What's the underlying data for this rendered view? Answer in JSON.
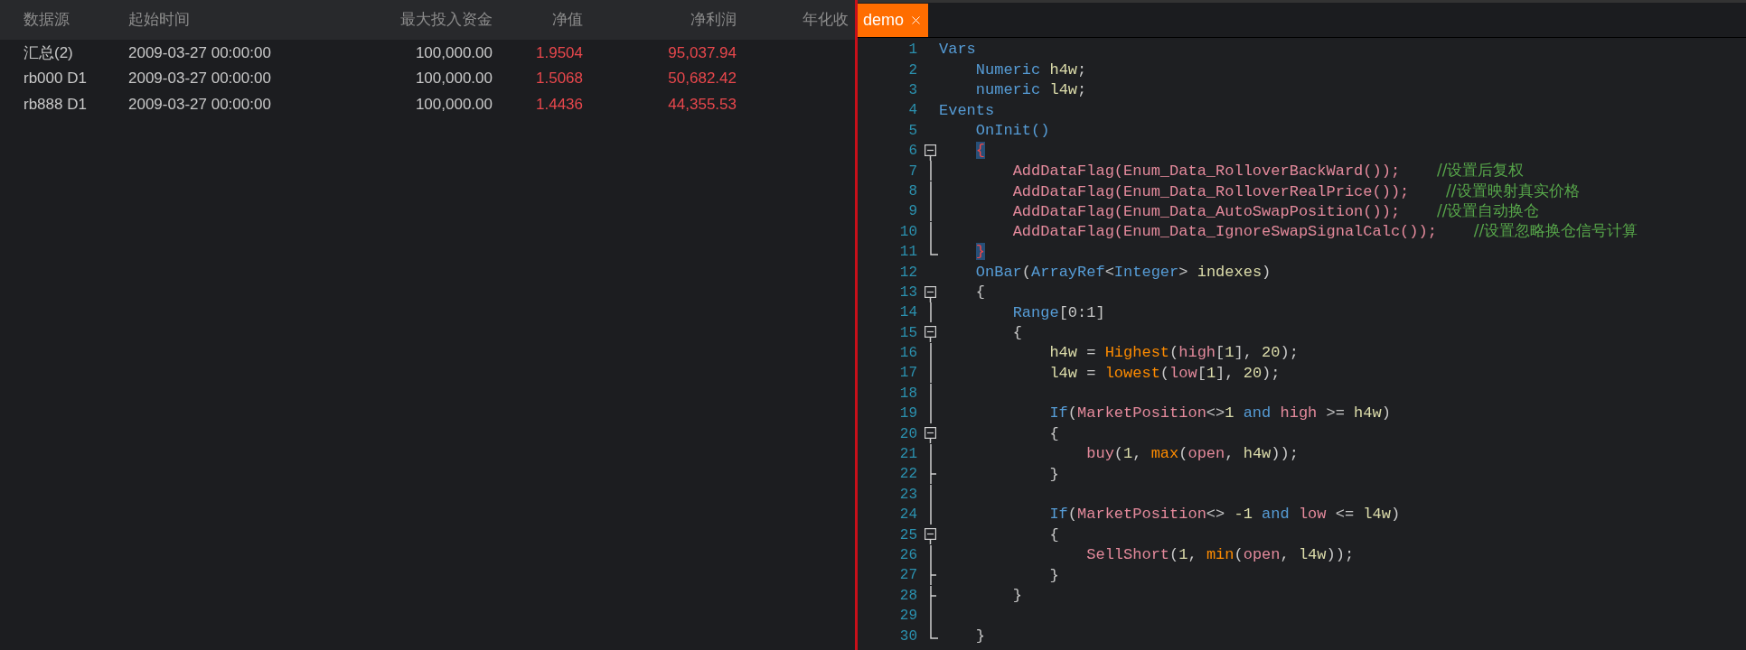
{
  "results_table": {
    "columns": [
      "数据源",
      "起始时间",
      "最大投入资金",
      "净值",
      "净利润",
      "年化收"
    ],
    "rows": [
      [
        "汇总(2)",
        "2009-03-27 00:00:00",
        "100,000.00",
        "1.9504",
        "95,037.94"
      ],
      [
        "rb000 D1",
        "2009-03-27 00:00:00",
        "100,000.00",
        "1.5068",
        "50,682.42"
      ],
      [
        "rb888 D1",
        "2009-03-27 00:00:00",
        "100,000.00",
        "1.4436",
        "44,355.53"
      ]
    ]
  },
  "editor": {
    "tabs": [
      {
        "label": "demo",
        "selected": true
      }
    ],
    "lines": [
      {
        "n": "1",
        "kind": "plain",
        "tokens": [
          {
            "kind": "kw",
            "t": "Vars"
          }
        ]
      },
      {
        "n": "2",
        "kind": "plain",
        "tokens": [
          {
            "kind": "kw",
            "t": "    Numeric "
          },
          {
            "kind": "var",
            "t": "h4w"
          },
          {
            "kind": "p",
            "t": ";"
          }
        ]
      },
      {
        "n": "3",
        "kind": "plain",
        "tokens": [
          {
            "kind": "kw",
            "t": "    numeric "
          },
          {
            "kind": "var",
            "t": "l4w"
          },
          {
            "kind": "p",
            "t": ";"
          }
        ]
      },
      {
        "n": "4",
        "kind": "plain",
        "tokens": [
          {
            "kind": "kw",
            "t": "Events"
          }
        ]
      },
      {
        "n": "5",
        "kind": "plain",
        "tokens": [
          {
            "kind": "kw",
            "t": "    OnInit()"
          }
        ]
      },
      {
        "n": "6",
        "kind": "open",
        "tokens": [
          {
            "kind": "brace",
            "t": "    {"
          }
        ]
      },
      {
        "n": "7",
        "kind": "line",
        "tokens": [
          {
            "kind": "fn",
            "t": "        AddDataFlag(Enum_Data_RolloverBackWard());"
          },
          {
            "kind": "comment",
            "t": "    //设置后复权"
          }
        ]
      },
      {
        "n": "8",
        "kind": "line",
        "tokens": [
          {
            "kind": "fn",
            "t": "        AddDataFlag(Enum_Data_RolloverRealPrice());"
          },
          {
            "kind": "comment",
            "t": "    //设置映射真实价格"
          }
        ]
      },
      {
        "n": "9",
        "kind": "line",
        "tokens": [
          {
            "kind": "fn",
            "t": "        AddDataFlag(Enum_Data_AutoSwapPosition());"
          },
          {
            "kind": "comment",
            "t": "    //设置自动换仓"
          }
        ]
      },
      {
        "n": "10",
        "kind": "line",
        "tokens": [
          {
            "kind": "fn",
            "t": "        AddDataFlag(Enum_Data_IgnoreSwapSignalCalc());"
          },
          {
            "kind": "comment",
            "t": "    //设置忽略换仓信号计算"
          }
        ]
      },
      {
        "n": "11",
        "kind": "end",
        "tokens": [
          {
            "kind": "brace",
            "t": "    }"
          }
        ]
      },
      {
        "n": "12",
        "kind": "plain",
        "tokens": [
          {
            "kind": "kw",
            "t": "    OnBar"
          },
          {
            "kind": "p",
            "t": "("
          },
          {
            "kind": "kw",
            "t": "ArrayRef"
          },
          {
            "kind": "p",
            "t": "<"
          },
          {
            "kind": "kw",
            "t": "Integer"
          },
          {
            "kind": "p",
            "t": "> "
          },
          {
            "kind": "var",
            "t": "indexes"
          },
          {
            "kind": "p",
            "t": ")"
          }
        ]
      },
      {
        "n": "13",
        "kind": "open",
        "tokens": [
          {
            "kind": "p",
            "t": "    {"
          }
        ]
      },
      {
        "n": "14",
        "kind": "line",
        "tokens": [
          {
            "kind": "kw",
            "t": "        Range"
          },
          {
            "kind": "p",
            "t": "[0:1]"
          }
        ]
      },
      {
        "n": "15",
        "kind": "open",
        "tokens": [
          {
            "kind": "p",
            "t": "        {"
          }
        ]
      },
      {
        "n": "16",
        "kind": "line",
        "tokens": [
          {
            "kind": "var",
            "t": "            h4w"
          },
          {
            "kind": "p",
            "t": " = "
          },
          {
            "kind": "builtin",
            "t": "Highest"
          },
          {
            "kind": "p",
            "t": "("
          },
          {
            "kind": "fn",
            "t": "high"
          },
          {
            "kind": "p",
            "t": "["
          },
          {
            "kind": "var",
            "t": "1"
          },
          {
            "kind": "p",
            "t": "], "
          },
          {
            "kind": "var",
            "t": "20"
          },
          {
            "kind": "p",
            "t": ");"
          }
        ]
      },
      {
        "n": "17",
        "kind": "line",
        "tokens": [
          {
            "kind": "var",
            "t": "            l4w"
          },
          {
            "kind": "p",
            "t": " = "
          },
          {
            "kind": "builtin",
            "t": "lowest"
          },
          {
            "kind": "p",
            "t": "("
          },
          {
            "kind": "fn",
            "t": "low"
          },
          {
            "kind": "p",
            "t": "["
          },
          {
            "kind": "var",
            "t": "1"
          },
          {
            "kind": "p",
            "t": "], "
          },
          {
            "kind": "var",
            "t": "20"
          },
          {
            "kind": "p",
            "t": ");"
          }
        ]
      },
      {
        "n": "18",
        "kind": "line"
      },
      {
        "n": "19",
        "kind": "line",
        "tokens": [
          {
            "kind": "kw",
            "t": "            If"
          },
          {
            "kind": "p",
            "t": "("
          },
          {
            "kind": "fn",
            "t": "MarketPosition"
          },
          {
            "kind": "p",
            "t": "<>"
          },
          {
            "kind": "var",
            "t": "1"
          },
          {
            "kind": "kw",
            "t": " and "
          },
          {
            "kind": "fn",
            "t": "high"
          },
          {
            "kind": "p",
            "t": " >= "
          },
          {
            "kind": "var",
            "t": "h4w"
          },
          {
            "kind": "p",
            "t": ")"
          }
        ]
      },
      {
        "n": "20",
        "kind": "open",
        "tokens": [
          {
            "kind": "p",
            "t": "            {"
          }
        ]
      },
      {
        "n": "21",
        "kind": "line",
        "tokens": [
          {
            "kind": "fn",
            "t": "                buy"
          },
          {
            "kind": "p",
            "t": "("
          },
          {
            "kind": "var",
            "t": "1"
          },
          {
            "kind": "p",
            "t": ", "
          },
          {
            "kind": "builtin",
            "t": "max"
          },
          {
            "kind": "p",
            "t": "("
          },
          {
            "kind": "fn",
            "t": "open"
          },
          {
            "kind": "p",
            "t": ", "
          },
          {
            "kind": "var",
            "t": "h4w"
          },
          {
            "kind": "p",
            "t": "));"
          }
        ]
      },
      {
        "n": "22",
        "kind": "tick",
        "tokens": [
          {
            "kind": "p",
            "t": "            }"
          }
        ]
      },
      {
        "n": "23",
        "kind": "line"
      },
      {
        "n": "24",
        "kind": "line",
        "tokens": [
          {
            "kind": "kw",
            "t": "            If"
          },
          {
            "kind": "p",
            "t": "("
          },
          {
            "kind": "fn",
            "t": "MarketPosition"
          },
          {
            "kind": "p",
            "t": "<> "
          },
          {
            "kind": "var",
            "t": "-1"
          },
          {
            "kind": "kw",
            "t": " and "
          },
          {
            "kind": "fn",
            "t": "low"
          },
          {
            "kind": "p",
            "t": " <= "
          },
          {
            "kind": "var",
            "t": "l4w"
          },
          {
            "kind": "p",
            "t": ")"
          }
        ]
      },
      {
        "n": "25",
        "kind": "open",
        "tokens": [
          {
            "kind": "p",
            "t": "            {"
          }
        ]
      },
      {
        "n": "26",
        "kind": "line",
        "tokens": [
          {
            "kind": "fn",
            "t": "                SellShort"
          },
          {
            "kind": "p",
            "t": "("
          },
          {
            "kind": "var",
            "t": "1"
          },
          {
            "kind": "p",
            "t": ", "
          },
          {
            "kind": "builtin",
            "t": "min"
          },
          {
            "kind": "p",
            "t": "("
          },
          {
            "kind": "fn",
            "t": "open"
          },
          {
            "kind": "p",
            "t": ", "
          },
          {
            "kind": "var",
            "t": "l4w"
          },
          {
            "kind": "p",
            "t": "));"
          }
        ]
      },
      {
        "n": "27",
        "kind": "tick",
        "tokens": [
          {
            "kind": "p",
            "t": "            }"
          }
        ]
      },
      {
        "n": "28",
        "kind": "tick",
        "tokens": [
          {
            "kind": "p",
            "t": "        }"
          }
        ]
      },
      {
        "n": "29",
        "kind": "line"
      },
      {
        "n": "30",
        "kind": "end",
        "tokens": [
          {
            "kind": "p",
            "t": "    }"
          }
        ]
      }
    ]
  }
}
